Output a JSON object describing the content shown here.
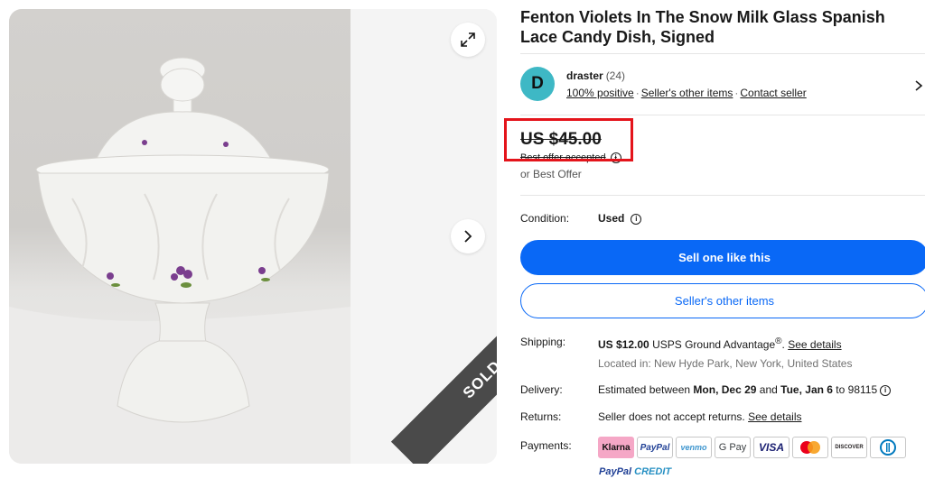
{
  "listing": {
    "title": "Fenton Violets In The Snow Milk Glass Spanish Lace Candy Dish, Signed",
    "sold_label": "SOLD"
  },
  "seller": {
    "avatar_letter": "D",
    "name": "draster",
    "feedback_count": "(24)",
    "positive": "100% positive",
    "other_items_link": "Seller's other items",
    "contact_link": "Contact seller"
  },
  "price": {
    "amount": "US $45.00",
    "best_offer_accepted": "Best offer accepted",
    "or_best_offer": "or Best Offer"
  },
  "condition": {
    "label": "Condition:",
    "value": "Used"
  },
  "buttons": {
    "sell_one": "Sell one like this",
    "sellers_items": "Seller's other items"
  },
  "shipping": {
    "label": "Shipping:",
    "cost": "US $12.00",
    "service": "USPS Ground Advantage",
    "registered": "®",
    "details_link": "See details",
    "location": "Located in: New Hyde Park, New York, United States"
  },
  "delivery": {
    "label": "Delivery:",
    "prefix": "Estimated between",
    "start": "Mon, Dec 29",
    "and": "and",
    "end": "Tue, Jan 6",
    "to": "to 98115"
  },
  "returns": {
    "label": "Returns:",
    "text": "Seller does not accept returns.",
    "details_link": "See details"
  },
  "payments": {
    "label": "Payments:",
    "methods": [
      "Klarna",
      "PayPal",
      "venmo",
      "G Pay",
      "VISA",
      "Mastercard",
      "DISCOVER",
      "Diners Club"
    ],
    "paypal_credit_a": "PayPal",
    "paypal_credit_b": "CREDIT"
  },
  "colors": {
    "primary_blue": "#0968f6",
    "highlight_red": "#e4141b",
    "avatar_teal": "#3eb8c5",
    "sold_band": "#4a4a4a"
  }
}
